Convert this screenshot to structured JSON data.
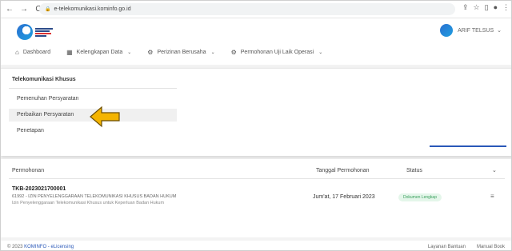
{
  "browser": {
    "back": "←",
    "forward": "→",
    "reload": "C",
    "url": "e-telekomunikasi.kominfo.go.id"
  },
  "header": {
    "user_name": "ARIF TELSUS"
  },
  "menu": [
    {
      "label": "Dashboard",
      "icon": "home-icon"
    },
    {
      "label": "Kelengkapan Data",
      "icon": "grid-icon"
    },
    {
      "label": "Perizinan Berusaha",
      "icon": "gear-icon"
    },
    {
      "label": "Permohonan Uji Laik Operasi",
      "icon": "gear-icon"
    }
  ],
  "dropdown": {
    "title": "Telekomunikasi Khusus",
    "items": [
      "Pemenuhan Persyaratan",
      "Perbaikan Persyaratan",
      "Penetapan"
    ],
    "active_index": 1
  },
  "table": {
    "headers": {
      "permohonan": "Permohonan",
      "tanggal": "Tanggal Permohonan",
      "status": "Status"
    },
    "rows": [
      {
        "id": "TKB-2023021700001",
        "desc": "61992 - IZIN PENYELENGGARAAN TELEKOMUNIKASI KHUSUS BADAN HUKUM",
        "sub": "Izin Penyelenggaraan Telekomunikasi Khusus untuk Keperluan Badan Hukum",
        "date": "Jum'at, 17 Februari 2023",
        "status": "Dokumen Lengkap"
      }
    ]
  },
  "footer": {
    "copyright": "© 2023",
    "brand": "KOMINFO - eLicensing",
    "links": [
      "Layanan Bantuan",
      "Manual Book"
    ]
  },
  "colors": {
    "accent": "#2a58b8",
    "badge_bg": "#e4f6ea",
    "badge_text": "#3a9f5c",
    "arrow": "#f4b400"
  }
}
